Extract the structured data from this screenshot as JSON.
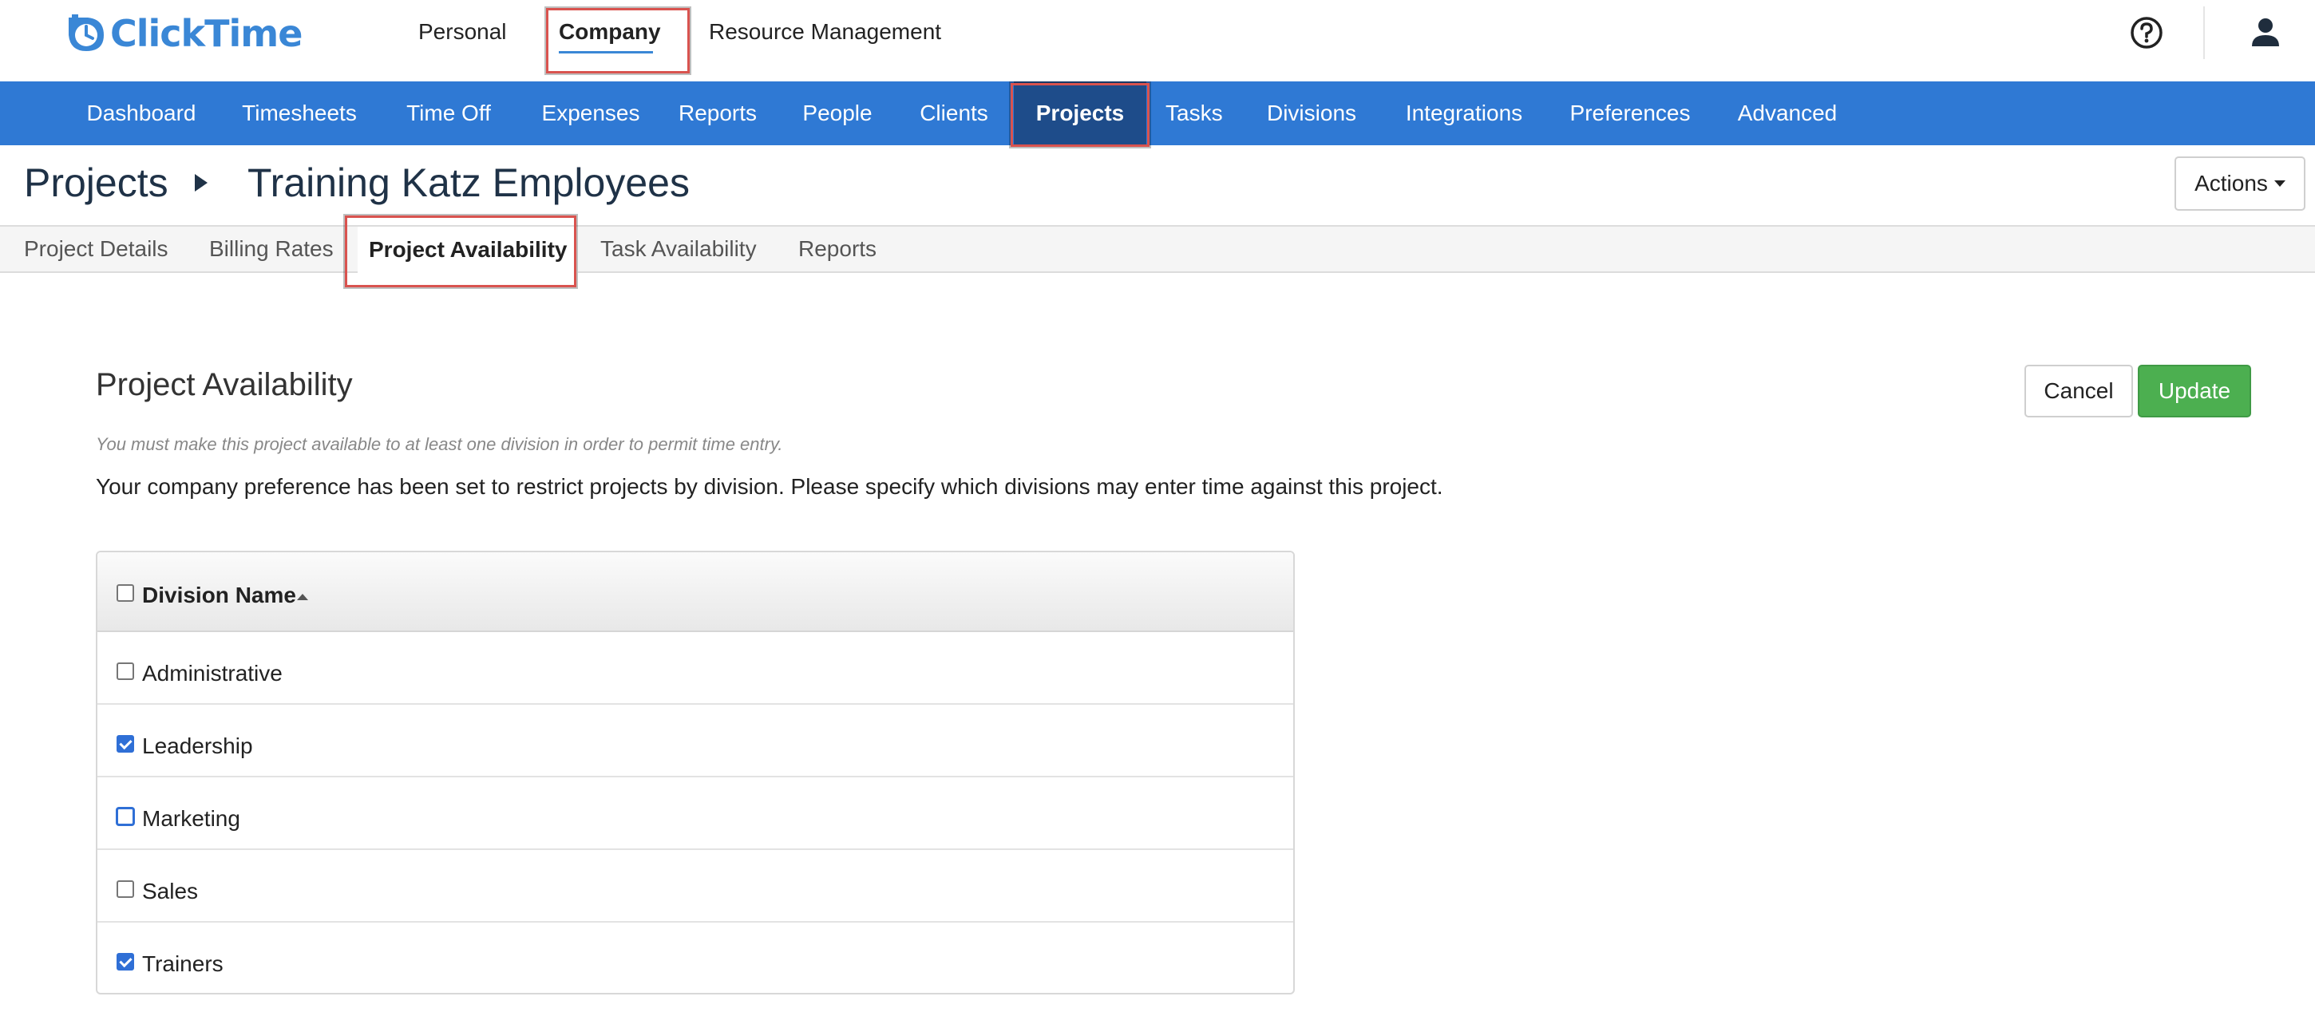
{
  "app": {
    "logo_text": "ClickTime",
    "brand_color": "#3a87d6",
    "nav_color": "#2f79d4",
    "highlight_color": "#d9534f"
  },
  "topnav": {
    "personal": "Personal",
    "company": "Company",
    "resource": "Resource Management",
    "active": "Company",
    "help_icon": "help-circle-icon",
    "user_icon": "user-icon"
  },
  "mainnav": {
    "items": [
      "Dashboard",
      "Timesheets",
      "Time Off",
      "Expenses",
      "Reports",
      "People",
      "Clients",
      "Projects",
      "Tasks",
      "Divisions",
      "Integrations",
      "Preferences",
      "Advanced"
    ],
    "active": "Projects"
  },
  "breadcrumb": {
    "root": "Projects",
    "leaf": "Training Katz Employees"
  },
  "actions": {
    "label": "Actions"
  },
  "subtabs": {
    "items": [
      "Project Details",
      "Billing Rates",
      "Project Availability",
      "Task Availability",
      "Reports"
    ],
    "active": "Project Availability"
  },
  "content": {
    "title": "Project Availability",
    "note": "You must make this project available to at least one division in order to permit time entry.",
    "description": "Your company preference has been set to restrict projects by division. Please specify which divisions may enter time against this project.",
    "cancel_label": "Cancel",
    "update_label": "Update"
  },
  "table": {
    "header": "Division Name",
    "select_all_checked": false,
    "rows": [
      {
        "name": "Administrative",
        "checked": false
      },
      {
        "name": "Leadership",
        "checked": true
      },
      {
        "name": "Marketing",
        "checked": false
      },
      {
        "name": "Sales",
        "checked": false
      },
      {
        "name": "Trainers",
        "checked": true
      }
    ]
  }
}
